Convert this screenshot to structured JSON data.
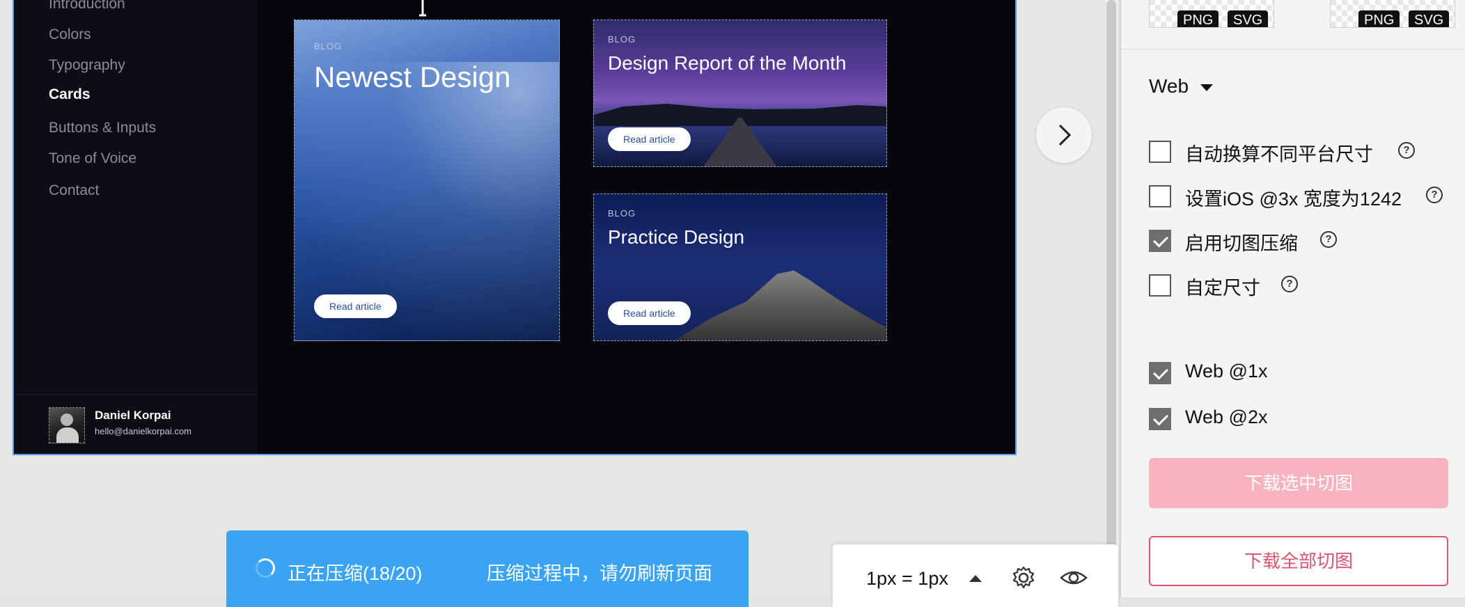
{
  "artboard": {
    "nav": {
      "items": [
        {
          "label": "Introduction",
          "active": false
        },
        {
          "label": "Colors",
          "active": false
        },
        {
          "label": "Typography",
          "active": false
        },
        {
          "label": "Cards",
          "active": true
        },
        {
          "label": "Buttons & Inputs",
          "active": false
        },
        {
          "label": "Tone of Voice",
          "active": false
        },
        {
          "label": "Contact",
          "active": false
        }
      ]
    },
    "profile": {
      "name": "Daniel Korpai",
      "email": "hello@danielkorpai.com"
    },
    "cards": [
      {
        "tag": "BLOG",
        "title": "Newest Design",
        "button": "Read article"
      },
      {
        "tag": "BLOG",
        "title": "Design Report of the Month",
        "button": "Read article"
      },
      {
        "tag": "BLOG",
        "title": "Practice Design",
        "button": "Read article"
      }
    ]
  },
  "right_panel": {
    "thumbnails": [
      {
        "badges": [
          "PNG",
          "SVG"
        ]
      },
      {
        "badges": [
          "PNG",
          "SVG"
        ]
      }
    ],
    "platform": "Web",
    "options": [
      {
        "label": "自动换算不同平台尺寸",
        "checked": false,
        "help": true
      },
      {
        "label": "设置iOS @3x 宽度为1242",
        "checked": false,
        "help": true
      },
      {
        "label": "启用切图压缩",
        "checked": true,
        "help": true
      },
      {
        "label": "自定尺寸",
        "checked": false,
        "help": true
      }
    ],
    "scales": [
      {
        "label": "Web @1x",
        "checked": true
      },
      {
        "label": "Web @2x",
        "checked": true
      }
    ],
    "download_selected": "下载选中切图",
    "download_all": "下载全部切图"
  },
  "compress_toast": {
    "status": "正在压缩(18/20)",
    "hint": "压缩过程中，请勿刷新页面"
  },
  "zoom_bar": {
    "zoom": "1px = 1px"
  },
  "colors": {
    "accent_blue": "#3aa3f2",
    "danger_pink": "#e0546f",
    "disabled_pink": "#f9b3bf",
    "artboard_bg": "#05050b"
  },
  "icons": [
    "chevron-right-icon",
    "help-icon",
    "caret-down-icon",
    "caret-up-icon",
    "gear-icon",
    "eye-icon",
    "spinner-icon"
  ]
}
